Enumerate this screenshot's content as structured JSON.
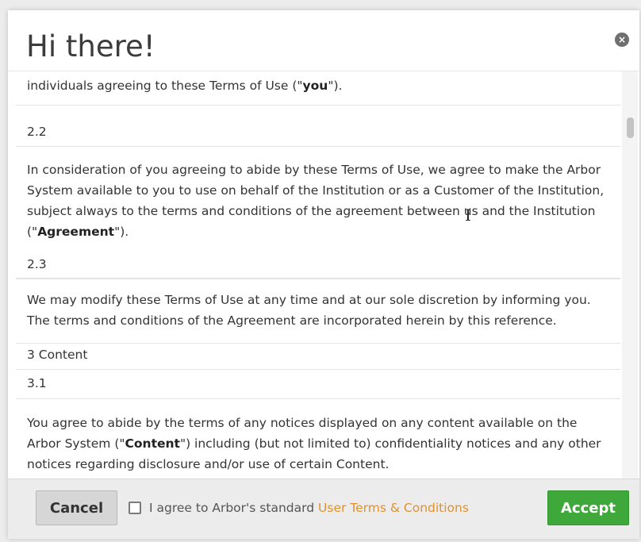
{
  "header": {
    "title": "Hi there!",
    "close_icon": "×"
  },
  "content": {
    "p1_prefix": "individuals agreeing to these Terms of Use (\"",
    "p1_bold": "you",
    "p1_suffix": "\").",
    "s2_2": "2.2",
    "p2_prefix": "In consideration of you agreeing to abide by these Terms of Use, we agree to make the Arbor System available to you to use on behalf of the Institution or as a Customer of the Institution, subject always to the terms and conditions of the agreement between us and the Institution (\"",
    "p2_bold": "Agreement",
    "p2_suffix": "\").",
    "s2_3": "2.3",
    "p3": "We may modify these Terms of Use at any time and at our sole discretion by informing you. The terms and conditions of the Agreement are incorporated herein by this reference.",
    "h3": "3 Content",
    "s3_1": "3.1",
    "p4_prefix": "You agree to abide by the terms of any notices displayed on any content available on the Arbor System (\"",
    "p4_bold": "Content",
    "p4_suffix": "\") including (but not limited to) confidentiality notices and any other notices regarding disclosure and/or use of certain Content."
  },
  "footer": {
    "cancel_label": "Cancel",
    "agree_text": "I agree to Arbor's standard",
    "terms_link": "User Terms & Conditions",
    "accept_label": "Accept"
  },
  "colors": {
    "accent_link": "#e0922c",
    "accept_green": "#3fa83a"
  },
  "icons": {
    "close": "close-icon",
    "checkbox": "checkbox-icon",
    "text_cursor": "text-cursor-icon"
  }
}
